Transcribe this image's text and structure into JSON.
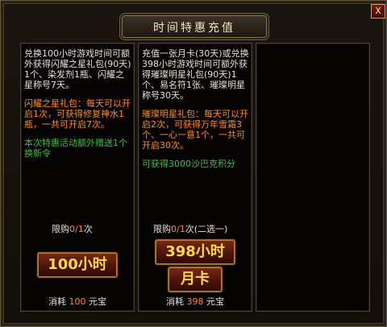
{
  "window": {
    "title": "时间特惠充值",
    "close_label": "X"
  },
  "offers": [
    {
      "description": "兑换100小时游戏时间可额外获得闪耀之星礼包(90天)1个、染发剂1瓶、闪耀之星称号7天。",
      "gift_info": "闪耀之星礼包：每天可以开启1次，可获得修复神水1瓶，一共可开启7次。",
      "bonus": "本次特惠活动额外赠送1个换新令",
      "limit_prefix": "限购",
      "limit_value": "0/1",
      "limit_suffix": "次",
      "button_label": "100小时",
      "cost_prefix": "消耗",
      "cost_value": "100",
      "cost_unit": "元宝"
    },
    {
      "description": "充值一张月卡(30天)或兑换398小时游戏时间可额外获得璀璨明星礼包(90天)1个、易名符1张、璀璨明星称号30天。",
      "gift_info": "璀璨明星礼包：每天可以开启2次，可获得万年雪霜3个、一心一意1个，一共可开启30次。",
      "bonus": "可获得3000沙巴克积分",
      "limit_prefix": "限购",
      "limit_value": "0/1",
      "limit_suffix": "次(二选一)",
      "button_label": "398小时",
      "button2_label": "月卡",
      "cost_prefix": "消耗",
      "cost_value": "398",
      "cost_unit": "元宝"
    }
  ]
}
